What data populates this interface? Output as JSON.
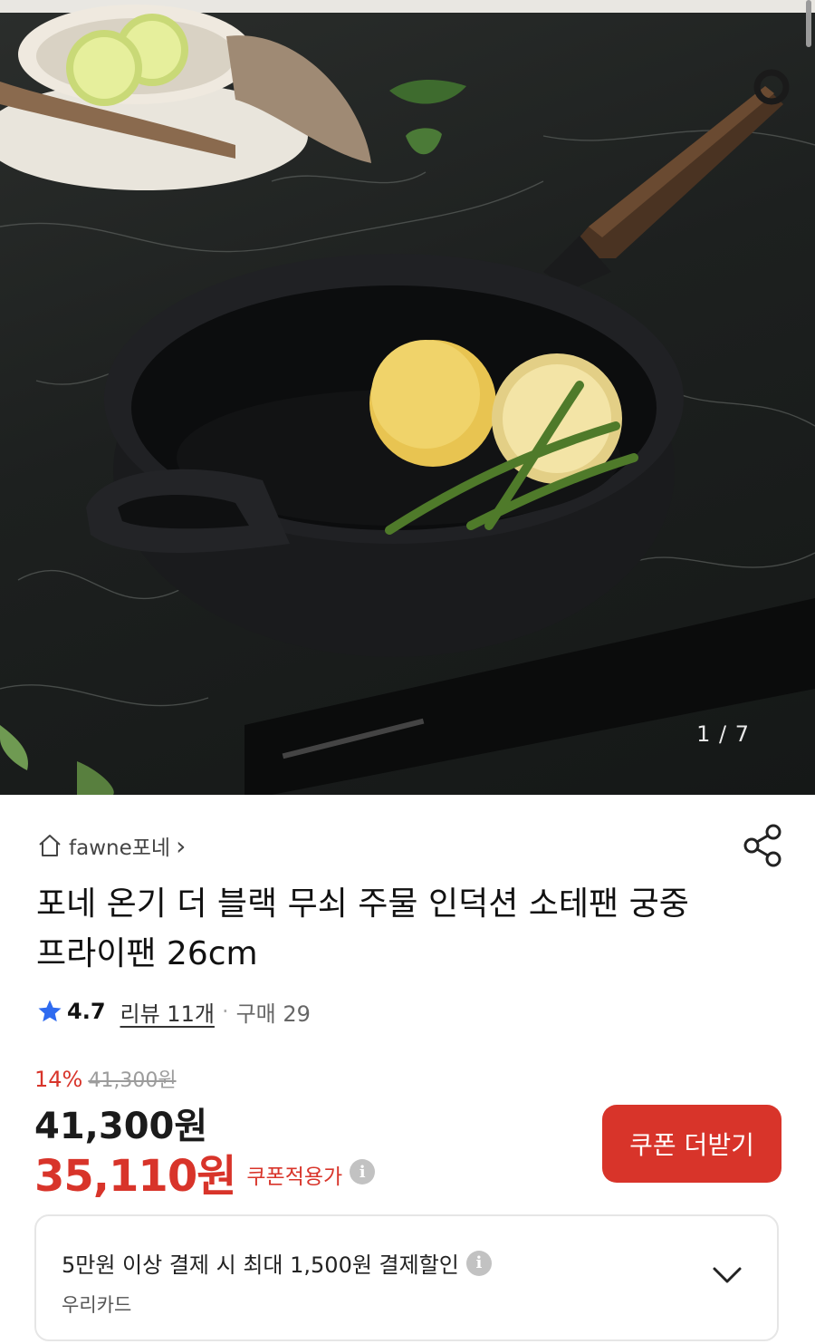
{
  "gallery": {
    "counter": "1 / 7",
    "image_alt": "cast iron frying pan with lemons and green beans on black marble"
  },
  "store": {
    "name": "fawne포네",
    "home_icon": "home-icon",
    "chevron": "›"
  },
  "share_icon": "share-icon",
  "product": {
    "title": "포네 온기 더 블랙 무쇠 주물 인덕션 소테팬 궁중 프라이팬 26cm"
  },
  "rating": {
    "score": "4.7",
    "review_label": "리뷰 11개",
    "separator": "·",
    "sales_label": "구매 29"
  },
  "pricing": {
    "discount_pct": "14%",
    "original": "41,300원",
    "price": "41,300원",
    "coupon_price": "35,110원",
    "coupon_label": "쿠폰적용가",
    "coupon_button": "쿠폰 더받기"
  },
  "card_offer": {
    "headline": "5만원 이상 결제 시 최대 1,500원 결제할인",
    "card_name": "우리카드"
  },
  "colors": {
    "accent_red": "#d8342a",
    "star_blue": "#2f6bf0"
  }
}
